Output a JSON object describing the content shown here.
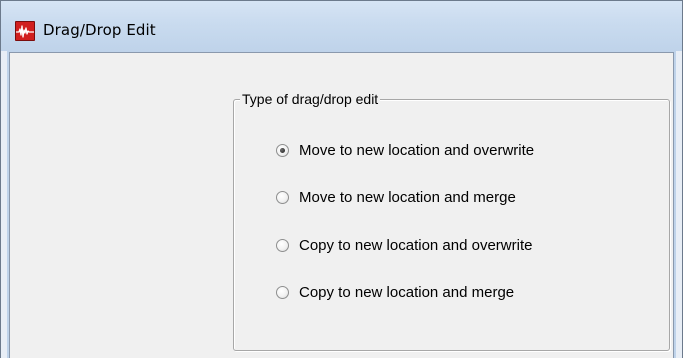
{
  "window": {
    "title": "Drag/Drop Edit",
    "icon": "waveform-app-icon"
  },
  "group": {
    "legend": "Type of drag/drop edit",
    "options": [
      {
        "label": "Move to new location and overwrite",
        "checked": true
      },
      {
        "label": "Move to new location and merge",
        "checked": false
      },
      {
        "label": "Copy to new location and overwrite",
        "checked": false
      },
      {
        "label": "Copy to new location and merge",
        "checked": false
      }
    ]
  },
  "colors": {
    "title_bar": "#c9dbef",
    "client_bg": "#f0f0f0",
    "icon_red": "#d11f1f"
  }
}
